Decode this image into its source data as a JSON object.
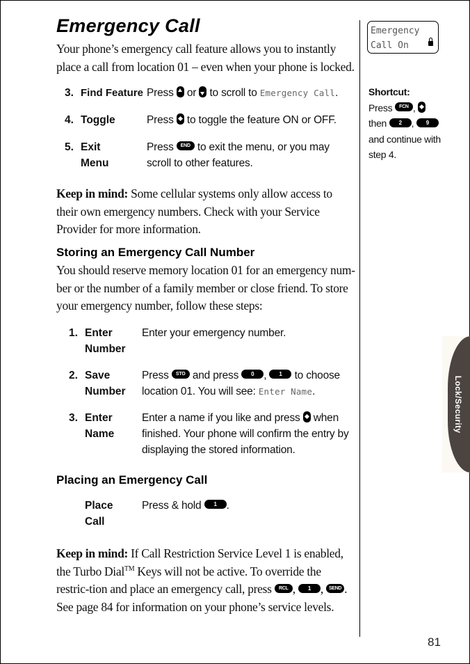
{
  "page": {
    "title": "Emergency Call",
    "intro": "Your phone’s emergency call feature allows you to instantly place a call from location 01 – even when your phone is locked.",
    "page_number": "81"
  },
  "steps_a": [
    {
      "num": "3.",
      "label": "Find Feature",
      "desc_pre": "Press",
      "key1": "up-arrow-key",
      "mid": "or",
      "key2": "down-arrow-key",
      "desc_post": "to scroll to",
      "lcd_text": "Emergency Call",
      "end": "."
    },
    {
      "num": "4.",
      "label": "Toggle",
      "desc_pre": "Press",
      "key1": "select-key",
      "desc_post": "to toggle the feature ON or OFF."
    },
    {
      "num": "5.",
      "label": "Exit Menu",
      "label_line1": "Exit",
      "label_line2": "Menu",
      "desc_pre": "Press",
      "key_label": "END",
      "desc_post": "to exit the menu, or you may scroll to other features."
    }
  ],
  "keep_in_mind_1": {
    "lead": "Keep in mind:",
    "text": "Some cellular systems only allow access to their own emergency numbers. Check with your Service Provider for more information."
  },
  "storing": {
    "heading": "Storing an Emergency Call Number",
    "text": "You should reserve memory location 01 for an emergency num-ber or the number of a family member or close friend. To store your emergency number, follow these steps:",
    "steps": [
      {
        "num": "1.",
        "label_line1": "Enter",
        "label_line2": "Number",
        "desc": "Enter your emergency number."
      },
      {
        "num": "2.",
        "label_line1": "Save",
        "label_line2": "Number",
        "desc_pre": "Press",
        "key_sto": "STO",
        "desc_mid": "and press",
        "key_0": "0",
        "key_1": "1",
        "desc_post": "to choose location 01. You will see:",
        "lcd_text": "Enter Name",
        "end": "."
      },
      {
        "num": "3.",
        "label_line1": "Enter",
        "label_line2": "Name",
        "desc_pre": "Enter a name if you like and press",
        "desc_post": "when finished. Your phone will confirm the entry by displaying the stored information."
      }
    ]
  },
  "placing": {
    "heading": "Placing an Emergency Call",
    "label_line1": "Place",
    "label_line2": "Call",
    "desc_pre": "Press & hold",
    "key_1": "1",
    "end": "."
  },
  "keep_in_mind_2": {
    "lead": "Keep in mind:",
    "text_1": "If Call Restriction Service Level 1 is enabled, the Turbo Dial",
    "tm": "TM",
    "text_2": "Keys will not be active. To override the restric-tion and place an emergency call, press",
    "key_rcl": "RCL",
    "key_1": "1",
    "key_send": "SEND",
    "text_3": ". See page 84 for information on your phone’s service levels."
  },
  "sidebar": {
    "lcd_line1": "Emergency",
    "lcd_line2": "Call On",
    "lcd_icon": "lock-icon",
    "shortcut_lead": "Shortcut:",
    "shortcut_press": "Press",
    "key_fcn": "FCN",
    "shortcut_then": "then",
    "key_2": "2",
    "key_9": "9",
    "shortcut_rest": "and continue with step 4."
  },
  "tab": {
    "label": "Lock/Security",
    "color": "#4b4441",
    "bg_color": "#fcf9f3"
  }
}
